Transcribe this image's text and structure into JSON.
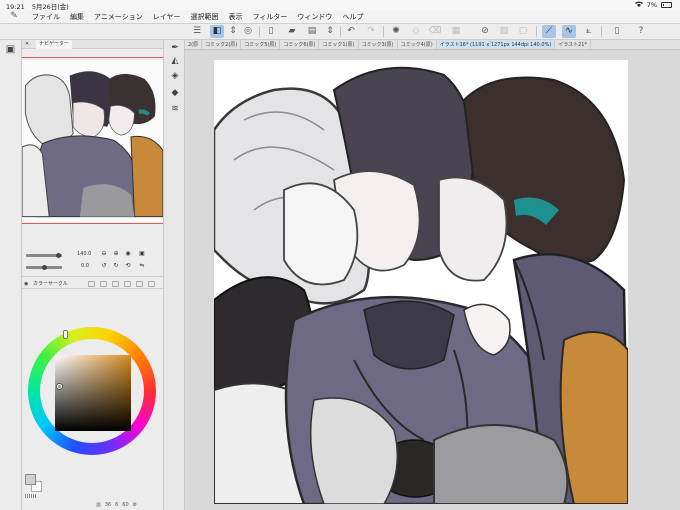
{
  "status": {
    "time": "19:21",
    "date": "5月26日(金)",
    "battery": "7%"
  },
  "menu": [
    "ファイル",
    "編集",
    "アニメーション",
    "レイヤー",
    "選択範囲",
    "表示",
    "フィルター",
    "ウィンドウ",
    "ヘルプ"
  ],
  "tabs": [
    "2(原",
    "コミック2(原)",
    "コミック5(原)",
    "コミック6(原)",
    "コミック1(原)",
    "コミック3(原)",
    "コミック4(原)",
    "イラスト16* (1191 x 1271px 144dpi 140.0%)",
    "イラスト21*"
  ],
  "navigator": {
    "title": "ナビゲーター",
    "zoom": "140.0",
    "rotation": "0.0"
  },
  "color_panel": {
    "title": "カラーサークル",
    "hue": "36",
    "saturation": "6",
    "brightness": "60",
    "colors": {
      "hue_indicator": "#d68a1e",
      "main": "#cfcfcf",
      "sub": "#ffffff"
    }
  },
  "icons": {
    "menu_logo": "clip-studio-logo-icon",
    "wifi": "wifi-icon",
    "battery": "battery-icon"
  }
}
